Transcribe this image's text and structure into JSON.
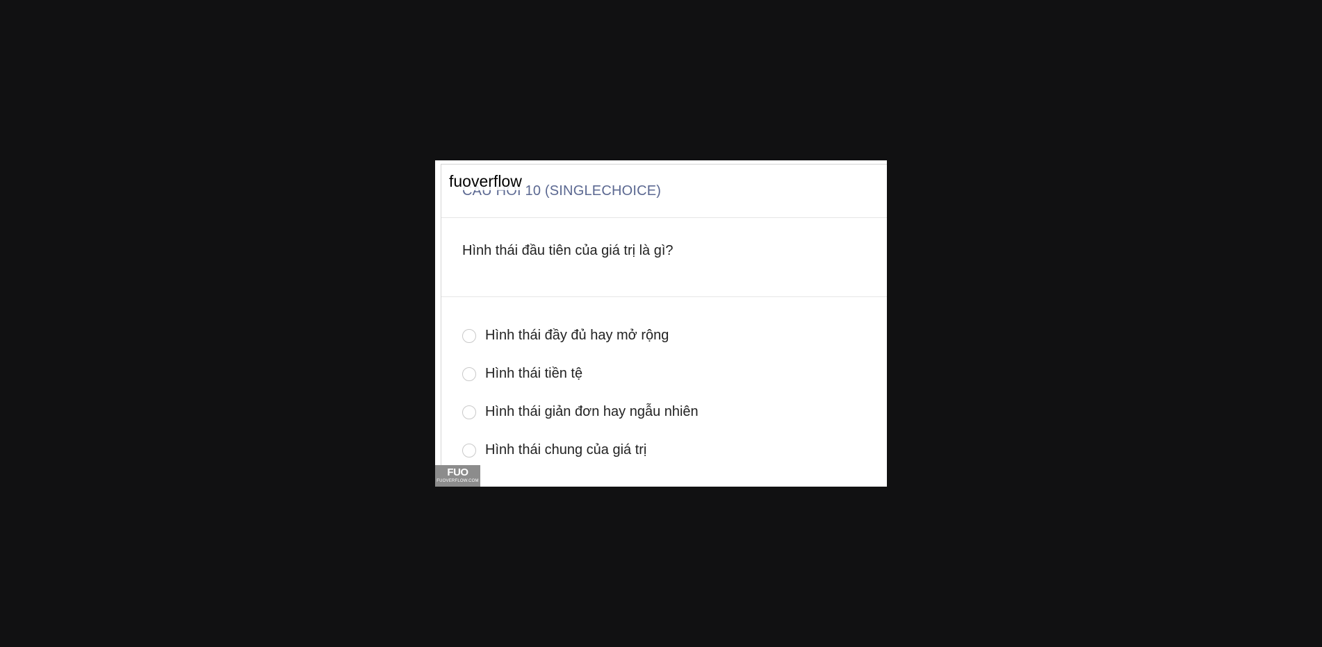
{
  "watermark": {
    "site": "fuoverflow",
    "logo_main": "FUO",
    "logo_sub": "FUOVERFLOW.COM"
  },
  "question_card": {
    "title": "CÂU HỎI 10 (SINGLECHOICE)",
    "question": "Hình thái đầu tiên của giá trị là gì?",
    "options": [
      {
        "label": "Hình thái đầy đủ hay mở rộng"
      },
      {
        "label": "Hình thái tiền tệ"
      },
      {
        "label": "Hình thái giản đơn hay ngẫu nhiên"
      },
      {
        "label": "Hình thái chung của giá trị"
      }
    ]
  },
  "colors": {
    "backdrop": "#111112",
    "title": "#5b6891",
    "text": "#222222",
    "radio_border": "#c9c9c9",
    "badge": "#8c8c8c"
  }
}
